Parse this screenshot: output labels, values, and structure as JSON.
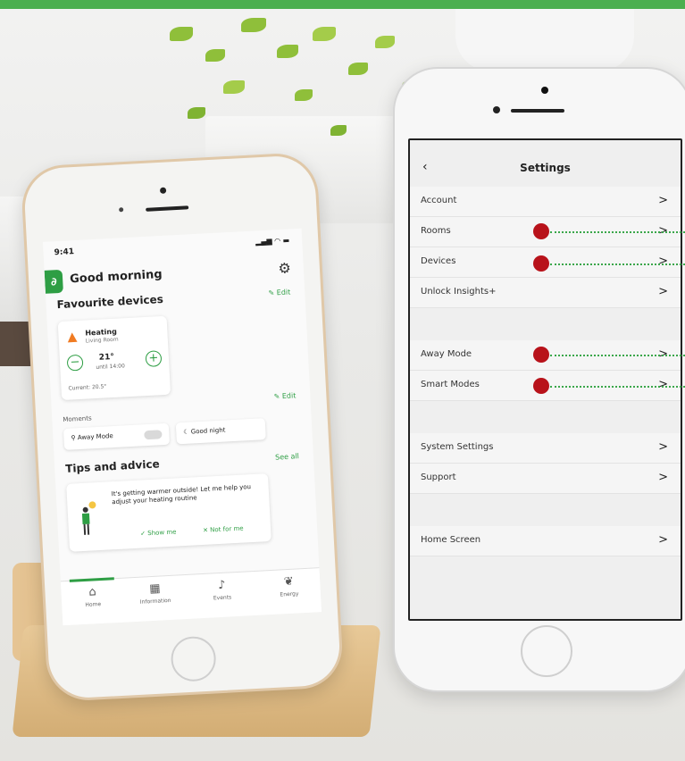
{
  "home_screen": {
    "time": "9:41",
    "greeting": "Good morning",
    "favourites_title": "Favourite devices",
    "edit_label": "Edit",
    "heating": {
      "name": "Heating",
      "room": "Living Room",
      "target": "21°",
      "until": "until 14:00",
      "current": "Current: 20.5°"
    },
    "moments_title": "Moments",
    "moments": [
      "Away Mode",
      "Good night"
    ],
    "tips_title": "Tips and advice",
    "see_all": "See all",
    "tip_text": "It's getting warmer outside! Let me help you adjust your heating routine",
    "tip_actions": [
      "Show me",
      "Not for me"
    ],
    "nav": [
      "Home",
      "Information",
      "Events",
      "Energy"
    ]
  },
  "settings_screen": {
    "title": "Settings",
    "rows": [
      {
        "label": "Account",
        "chevron": ">"
      },
      {
        "label": "Rooms",
        "chevron": ">"
      },
      {
        "label": "Devices",
        "chevron": ">"
      },
      {
        "label": "Unlock Insights+",
        "chevron": ">"
      },
      {
        "label": "Away Mode",
        "chevron": ">"
      },
      {
        "label": "Smart Modes",
        "chevron": ">"
      },
      {
        "label": "System Settings",
        "chevron": ">"
      },
      {
        "label": "Support",
        "chevron": ">"
      },
      {
        "label": "Home Screen",
        "chevron": ">"
      }
    ]
  },
  "colors": {
    "brand_green": "#2e9e44",
    "marker_red": "#b8121a",
    "top_band": "#4caf50"
  },
  "icons": {
    "back": "‹",
    "gear": "⚙",
    "flame": "🔥"
  }
}
